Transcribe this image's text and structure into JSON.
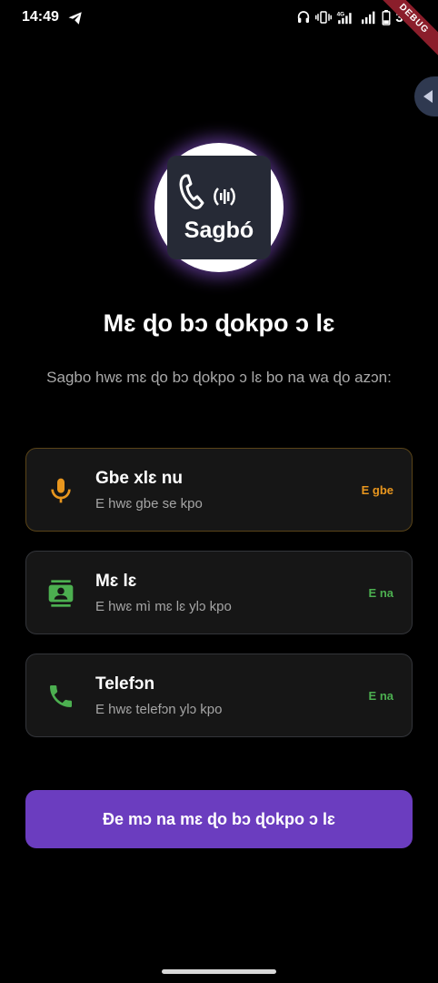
{
  "status_bar": {
    "time": "14:49",
    "battery_level": "30",
    "debug_label": "DEBUG",
    "icons": [
      "telegram-icon",
      "headphones-icon",
      "vibrate-icon",
      "network-4g-icon",
      "signal-icon",
      "battery-icon"
    ]
  },
  "logo": {
    "text": "Sagbó"
  },
  "title": "Mɛ ɖo bɔ ɖokpo ɔ lɛ",
  "subtitle": "Sagbo hwɛ mɛ ɖo bɔ ɖokpo ɔ lɛ bo na wa ɖo azɔn:",
  "permissions": [
    {
      "name": "Gbe xlɛ nu",
      "description": "E hwɛ gbe se kpo",
      "status": "E gbe",
      "icon": "microphone-icon",
      "color": "#e8961e"
    },
    {
      "name": "Mɛ lɛ",
      "description": "E hwɛ mì mɛ lɛ ylɔ kpo",
      "status": "E na",
      "icon": "contacts-icon",
      "color": "#4caf50"
    },
    {
      "name": "Telefɔn",
      "description": "E hwɛ telefɔn ylɔ kpo",
      "status": "E na",
      "icon": "phone-icon",
      "color": "#4caf50"
    }
  ],
  "primary_button": {
    "label": "Ɖe mɔ na mɛ ɖo bɔ ɖokpo ɔ lɛ"
  },
  "colors": {
    "accent": "#6b3dbf",
    "granted": "#4caf50",
    "pending": "#e8961e"
  }
}
